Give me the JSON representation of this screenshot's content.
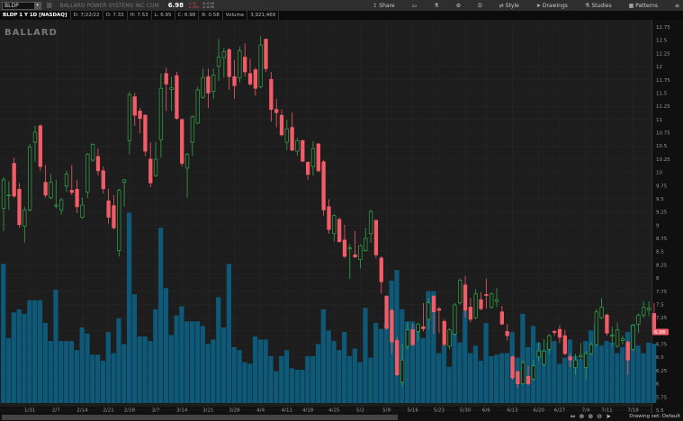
{
  "header": {
    "symbol": "BLDP",
    "company": "BALLARD POWER SYSTEMS INC COM",
    "last": "6.98",
    "change": "-0.35",
    "change_pct": "-4.78%",
    "bid": "B: 6.96",
    "ask": "A: 6.98"
  },
  "toolbar": {
    "share": "Share",
    "style": "Style",
    "drawings": "Drawings",
    "studies": "Studies",
    "patterns": "Patterns",
    "d": "D"
  },
  "info": {
    "title": "BLDP 1 Y 1D [NASDAQ]",
    "date": "D: 7/22/22",
    "open": "O: 7.33",
    "high": "H: 7.53",
    "low": "L: 6.95",
    "close": "C: 6.98",
    "range": "R: 0.58",
    "volume_label": "Volume",
    "volume": "3,921,469"
  },
  "watermark": "BALLARD",
  "footer": {
    "drawing_set": "Drawing set: Default"
  },
  "colors": {
    "up": "#35a54a",
    "down": "#f25c68",
    "volume": "#0e5878",
    "bg": "#1d1d1d"
  },
  "chart_data": {
    "type": "candlestick",
    "ylabel": "Price",
    "ylim": [
      5.5,
      12.75
    ],
    "yticks": [
      "12.75",
      "12.5",
      "12.25",
      "12",
      "11.75",
      "11.5",
      "11.25",
      "11",
      "10.75",
      "10.5",
      "10.25",
      "10",
      "9.75",
      "9.5",
      "9.25",
      "9",
      "8.75",
      "8.5",
      "8.25",
      "8",
      "7.75",
      "7.5",
      "7.25",
      "7",
      "6.75",
      "6.5",
      "6.25",
      "6",
      "5.75",
      "5.5"
    ],
    "last_price_label": "6.98",
    "xticks": [
      {
        "label": "1/31",
        "index": 5
      },
      {
        "label": "2/7",
        "index": 10
      },
      {
        "label": "2/14",
        "index": 15
      },
      {
        "label": "2/21",
        "index": 20
      },
      {
        "label": "2/28",
        "index": 24
      },
      {
        "label": "3/7",
        "index": 29
      },
      {
        "label": "3/14",
        "index": 34
      },
      {
        "label": "3/21",
        "index": 39
      },
      {
        "label": "3/28",
        "index": 44
      },
      {
        "label": "4/4",
        "index": 49
      },
      {
        "label": "4/11",
        "index": 54
      },
      {
        "label": "4/18",
        "index": 58
      },
      {
        "label": "4/25",
        "index": 63
      },
      {
        "label": "5/2",
        "index": 68
      },
      {
        "label": "5/9",
        "index": 73
      },
      {
        "label": "5/16",
        "index": 78
      },
      {
        "label": "5/23",
        "index": 83
      },
      {
        "label": "5/30",
        "index": 88
      },
      {
        "label": "6/6",
        "index": 92
      },
      {
        "label": "6/13",
        "index": 97
      },
      {
        "label": "6/20",
        "index": 102
      },
      {
        "label": "6/27",
        "index": 106
      },
      {
        "label": "7/4",
        "index": 111
      },
      {
        "label": "7/11",
        "index": 115
      },
      {
        "label": "7/18",
        "index": 120
      }
    ],
    "volume_unit": "millions",
    "ohlcv": [
      [
        9.32,
        9.91,
        8.89,
        9.86,
        9.2
      ],
      [
        9.57,
        9.83,
        9.29,
        9.57,
        4.3
      ],
      [
        10.17,
        10.28,
        9.52,
        9.55,
        6.0
      ],
      [
        9.68,
        9.8,
        8.95,
        9.01,
        6.2
      ],
      [
        8.98,
        9.35,
        8.67,
        9.29,
        5.9
      ],
      [
        9.29,
        10.54,
        9.26,
        10.48,
        6.8
      ],
      [
        10.57,
        10.88,
        10.2,
        10.76,
        6.8
      ],
      [
        10.88,
        10.91,
        10.03,
        10.11,
        6.8
      ],
      [
        9.81,
        10.14,
        9.52,
        9.57,
        5.3
      ],
      [
        9.52,
        9.97,
        9.49,
        9.81,
        4.1
      ],
      [
        9.36,
        9.86,
        9.32,
        9.38,
        7.5
      ],
      [
        9.29,
        9.52,
        9.2,
        9.48,
        4.1
      ],
      [
        9.74,
        10.03,
        9.63,
        9.97,
        4.1
      ],
      [
        9.66,
        10.14,
        9.57,
        9.62,
        4.1
      ],
      [
        9.68,
        9.86,
        9.23,
        9.35,
        3.5
      ],
      [
        9.15,
        9.52,
        9.12,
        9.38,
        5.0
      ],
      [
        9.63,
        10.37,
        9.52,
        10.34,
        4.6
      ],
      [
        10.23,
        10.55,
        10.2,
        10.53,
        3.2
      ],
      [
        10.3,
        10.45,
        9.94,
        10.03,
        3.2
      ],
      [
        10.03,
        10.11,
        9.6,
        9.69,
        2.8
      ],
      [
        9.46,
        9.69,
        9.03,
        9.15,
        4.7
      ],
      [
        9.37,
        9.57,
        8.92,
        8.95,
        3.3
      ],
      [
        8.52,
        9.69,
        8.41,
        9.66,
        5.6
      ],
      [
        9.81,
        9.87,
        9.35,
        9.86,
        3.9
      ],
      [
        10.6,
        11.53,
        10.34,
        11.47,
        12.6
      ],
      [
        11.43,
        11.5,
        10.88,
        11.08,
        7.2
      ],
      [
        11.16,
        11.22,
        10.74,
        11.02,
        4.4
      ],
      [
        11.08,
        11.1,
        10.31,
        10.4,
        4.4
      ],
      [
        10.25,
        10.57,
        9.72,
        9.8,
        4.1
      ],
      [
        9.94,
        10.57,
        9.91,
        10.25,
        6.2
      ],
      [
        10.62,
        11.87,
        10.28,
        11.59,
        11.6
      ],
      [
        11.87,
        11.98,
        11.16,
        11.67,
        7.6
      ],
      [
        11.57,
        11.81,
        11.16,
        11.6,
        4.5
      ],
      [
        11.83,
        11.9,
        10.99,
        11.02,
        5.8
      ],
      [
        11.0,
        11.02,
        10.11,
        10.17,
        6.4
      ],
      [
        10.08,
        10.37,
        9.52,
        10.34,
        5.4
      ],
      [
        10.57,
        11.08,
        10.31,
        11.05,
        5.4
      ],
      [
        10.93,
        11.62,
        10.91,
        11.56,
        5.4
      ],
      [
        11.42,
        11.96,
        11.39,
        11.79,
        5.1
      ],
      [
        11.81,
        11.96,
        11.22,
        11.5,
        3.9
      ],
      [
        11.53,
        11.96,
        11.39,
        11.84,
        4.2
      ],
      [
        12.01,
        12.52,
        11.73,
        12.18,
        7.0
      ],
      [
        12.17,
        12.35,
        11.79,
        12.28,
        5.0
      ],
      [
        12.32,
        12.35,
        11.56,
        11.81,
        9.2
      ],
      [
        11.81,
        12.13,
        11.39,
        11.64,
        3.7
      ],
      [
        11.79,
        12.38,
        11.7,
        12.3,
        3.5
      ],
      [
        12.18,
        12.44,
        11.81,
        11.9,
        2.7
      ],
      [
        11.87,
        12.15,
        11.64,
        11.67,
        2.6
      ],
      [
        11.94,
        11.98,
        11.45,
        11.59,
        4.4
      ],
      [
        11.62,
        12.58,
        11.59,
        12.41,
        4.2
      ],
      [
        12.52,
        12.53,
        11.9,
        11.96,
        4.2
      ],
      [
        11.76,
        11.9,
        10.96,
        11.19,
        3.1
      ],
      [
        11.19,
        11.39,
        10.85,
        11.13,
        2.1
      ],
      [
        11.08,
        11.19,
        10.68,
        10.71,
        3.1
      ],
      [
        10.57,
        10.99,
        10.42,
        10.82,
        3.5
      ],
      [
        10.85,
        11.13,
        10.4,
        10.42,
        2.3
      ],
      [
        10.4,
        10.65,
        10.31,
        10.6,
        2.2
      ],
      [
        10.6,
        10.62,
        10.2,
        10.21,
        2.2
      ],
      [
        10.19,
        10.21,
        9.86,
        9.96,
        3.1
      ],
      [
        10.11,
        10.59,
        9.94,
        10.45,
        3.1
      ],
      [
        10.54,
        10.55,
        10.0,
        10.03,
        3.9
      ],
      [
        10.2,
        10.23,
        9.18,
        9.29,
        6.2
      ],
      [
        9.35,
        9.49,
        8.84,
        8.92,
        4.8
      ],
      [
        8.84,
        9.21,
        8.69,
        9.18,
        4.1
      ],
      [
        9.11,
        9.15,
        8.67,
        8.69,
        3.5
      ],
      [
        8.72,
        9.01,
        8.38,
        8.41,
        4.7
      ],
      [
        8.55,
        8.64,
        7.99,
        8.57,
        3.1
      ],
      [
        8.44,
        8.89,
        8.38,
        8.4,
        3.6
      ],
      [
        8.35,
        8.64,
        8.18,
        8.61,
        2.7
      ],
      [
        8.52,
        8.95,
        8.5,
        8.75,
        6.3
      ],
      [
        8.84,
        9.29,
        8.67,
        9.26,
        3.0
      ],
      [
        9.09,
        9.11,
        8.38,
        8.44,
        5.3
      ],
      [
        8.38,
        8.41,
        7.7,
        7.93,
        4.9
      ],
      [
        7.66,
        7.67,
        7.02,
        7.05,
        5.3
      ],
      [
        7.39,
        7.42,
        6.57,
        6.79,
        8.1
      ],
      [
        6.82,
        6.88,
        6.14,
        6.17,
        8.8
      ],
      [
        6.03,
        6.77,
        5.94,
        6.45,
        6.2
      ],
      [
        6.71,
        7.16,
        6.65,
        7.02,
        5.4
      ],
      [
        7.02,
        7.13,
        6.71,
        6.74,
        5.4
      ],
      [
        6.99,
        7.16,
        6.82,
        7.13,
        5.1
      ],
      [
        7.08,
        7.53,
        6.99,
        7.04,
        4.3
      ],
      [
        7.22,
        7.62,
        7.02,
        7.53,
        7.4
      ],
      [
        7.66,
        7.67,
        6.94,
        7.36,
        7.4
      ],
      [
        7.42,
        7.45,
        6.96,
        7.39,
        3.3
      ],
      [
        7.18,
        7.22,
        6.71,
        6.74,
        3.8
      ],
      [
        6.71,
        7.05,
        6.65,
        7.02,
        2.4
      ],
      [
        6.94,
        7.53,
        6.91,
        7.49,
        4.7
      ],
      [
        7.53,
        7.99,
        7.5,
        7.96,
        4.0
      ],
      [
        7.87,
        8.04,
        7.25,
        7.39,
        6.1
      ],
      [
        7.45,
        7.62,
        7.16,
        7.22,
        3.3
      ],
      [
        7.25,
        7.79,
        7.22,
        7.7,
        3.8
      ],
      [
        7.59,
        7.73,
        7.39,
        7.42,
        2.8
      ],
      [
        7.69,
        7.99,
        7.42,
        7.67,
        5.3
      ],
      [
        7.45,
        7.73,
        7.42,
        7.7,
        3.1
      ],
      [
        7.56,
        7.81,
        7.45,
        7.59,
        3.2
      ],
      [
        7.36,
        7.47,
        7.11,
        7.13,
        3.3
      ],
      [
        6.99,
        7.13,
        6.82,
        6.91,
        3.3
      ],
      [
        6.51,
        6.54,
        6.08,
        6.11,
        4.7
      ],
      [
        6.23,
        6.25,
        5.92,
        6.0,
        3.0
      ],
      [
        6.0,
        6.45,
        5.97,
        6.4,
        5.9
      ],
      [
        6.14,
        6.34,
        5.97,
        6.0,
        3.7
      ],
      [
        6.09,
        6.45,
        6.06,
        6.34,
        5.1
      ],
      [
        6.51,
        6.79,
        6.43,
        6.62,
        4.0
      ],
      [
        6.37,
        6.85,
        6.34,
        6.62,
        3.5
      ],
      [
        6.65,
        6.94,
        6.57,
        6.91,
        4.0
      ],
      [
        6.99,
        7.02,
        6.91,
        6.97,
        4.1
      ],
      [
        7.03,
        7.11,
        6.77,
        6.88,
        2.6
      ],
      [
        6.91,
        7.02,
        6.54,
        6.57,
        3.0
      ],
      [
        6.51,
        6.57,
        6.31,
        6.45,
        4.2
      ],
      [
        6.31,
        6.57,
        6.17,
        6.45,
        3.1
      ],
      [
        6.51,
        6.77,
        6.45,
        6.54,
        2.9
      ],
      [
        6.31,
        6.62,
        6.09,
        6.57,
        4.1
      ],
      [
        6.57,
        6.79,
        6.54,
        6.74,
        4.8
      ],
      [
        6.74,
        7.42,
        6.71,
        7.36,
        5.2
      ],
      [
        7.25,
        7.62,
        7.22,
        7.45,
        3.8
      ],
      [
        7.3,
        7.33,
        6.91,
        6.96,
        4.1
      ],
      [
        6.9,
        7.08,
        6.71,
        6.92,
        4.0
      ],
      [
        6.71,
        7.16,
        6.68,
        7.02,
        3.3
      ],
      [
        6.82,
        6.91,
        6.74,
        6.85,
        3.7
      ],
      [
        6.79,
        6.82,
        6.17,
        6.45,
        4.7
      ],
      [
        6.65,
        7.13,
        6.62,
        7.11,
        5.2
      ],
      [
        7.13,
        7.33,
        6.96,
        7.3,
        3.8
      ],
      [
        7.3,
        7.56,
        7.25,
        7.45,
        3.3
      ],
      [
        7.4,
        7.56,
        7.28,
        7.43,
        4.0
      ],
      [
        7.33,
        7.53,
        6.95,
        6.98,
        3.92
      ]
    ]
  }
}
